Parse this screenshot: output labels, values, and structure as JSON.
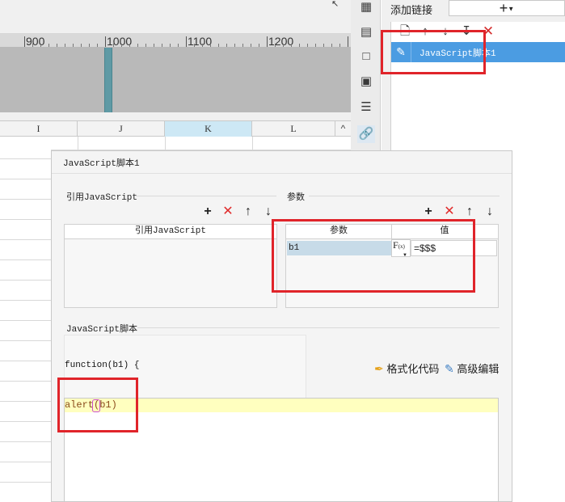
{
  "ruler": {
    "labels": [
      "900",
      "1000",
      "1100",
      "1200"
    ]
  },
  "sheet": {
    "columns": [
      "I",
      "J",
      "K",
      "L"
    ],
    "selected_column": "K",
    "scroll_up_glyph": "^"
  },
  "side_toolbar": {
    "icons": [
      "grid-icon",
      "info-table-icon",
      "rectangle-icon",
      "dropdown-box-icon",
      "list-icon",
      "link-icon"
    ],
    "active": "link-icon"
  },
  "right_panel": {
    "add_link_label": "添加链接",
    "add_button_symbol": "+",
    "toolbar_icons": [
      "copy-icon",
      "move-up-icon",
      "move-down-icon",
      "move-bottom-icon",
      "delete-icon"
    ],
    "items": [
      {
        "label": "JavaScript脚本1",
        "selected": true
      }
    ]
  },
  "dialog": {
    "title": "JavaScript脚本1",
    "ref_section": {
      "title": "引用JavaScript",
      "column_header": "引用JavaScript",
      "rows": []
    },
    "params_section": {
      "title": "参数",
      "headers": [
        "参数",
        "值"
      ],
      "rows": [
        {
          "name": "b1",
          "fx_label": "F",
          "fx_sub": "(x)",
          "value": "=$$$"
        }
      ]
    },
    "script_section": {
      "title": "JavaScript脚本",
      "function_signature": "function(b1) {",
      "format_code_label": "格式化代码",
      "advanced_edit_label": "高级编辑",
      "code_line": "alert(b1)"
    }
  },
  "colors": {
    "accent": "#4b9ce2",
    "highlight_red": "#e0242a",
    "editor_line": "#ffffbf",
    "timeline_marker": "#5f9aa5"
  }
}
